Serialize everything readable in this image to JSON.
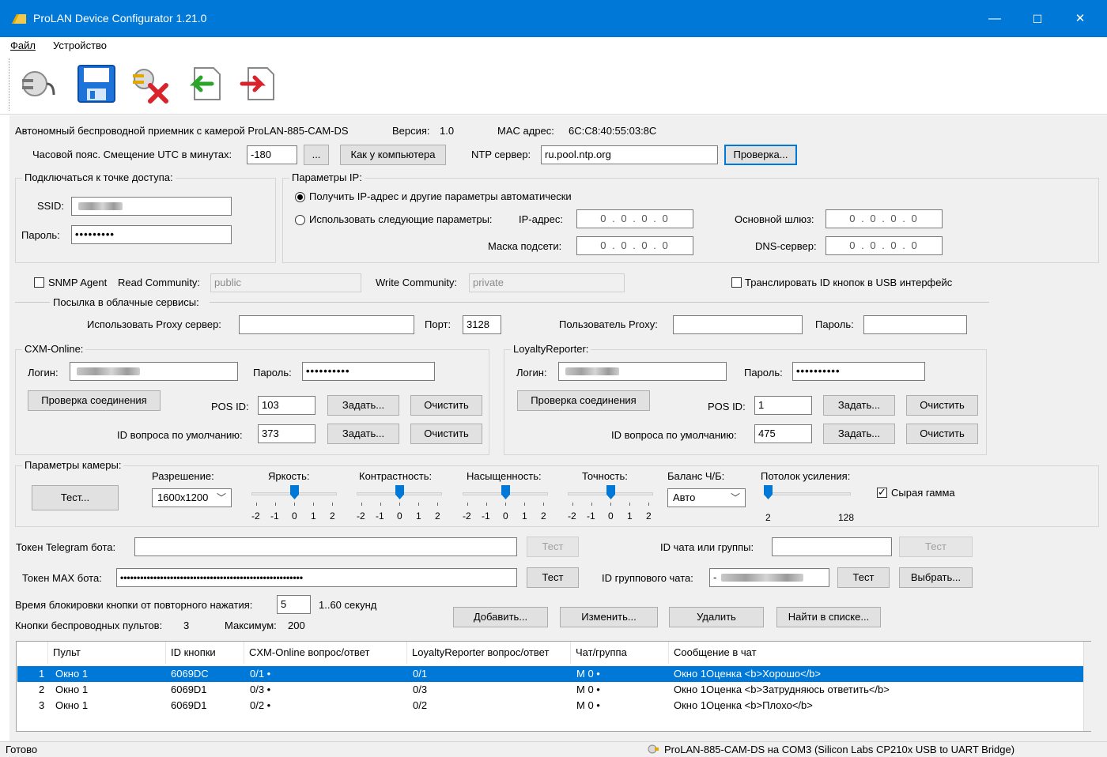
{
  "window": {
    "title": "ProLAN Device Configurator 1.21.0",
    "minimize": "—",
    "maximize": "☐",
    "close": "✕"
  },
  "menu": {
    "file": "Файл",
    "device": "Устройство"
  },
  "toolbar": {
    "icons": [
      "connect-icon",
      "save-icon",
      "disconnect-icon",
      "import-icon",
      "export-icon"
    ]
  },
  "device": {
    "name": "Автономный беспроводной приемник с камерой ProLAN-885-CAM-DS",
    "version_label": "Версия:",
    "version": "1.0",
    "mac_label": "MAC адрес:",
    "mac": "6C:C8:40:55:03:8C"
  },
  "time": {
    "tz_label": "Часовой пояс. Смещение UTC в минутах:",
    "tz_value": "-180",
    "ellipsis_button": "...",
    "like_pc_button": "Как у компьютера",
    "ntp_label": "NTP сервер:",
    "ntp_value": "ru.pool.ntp.org",
    "check_button": "Проверка..."
  },
  "wifi": {
    "group_title": "Подключаться к точке доступа:",
    "ssid_label": "SSID:",
    "password_label": "Пароль:",
    "password_value": "•••••••••"
  },
  "ip": {
    "group_title": "Параметры IP:",
    "auto_label": "Получить IP-адрес и другие параметры автоматически",
    "manual_label": "Использовать следующие параметры:",
    "ip_label": "IP-адрес:",
    "mask_label": "Маска подсети:",
    "gateway_label": "Основной шлюз:",
    "dns_label": "DNS-сервер:",
    "ip_value": "0 . 0 . 0 . 0",
    "mask_value": "0 . 0 . 0 . 0",
    "gateway_value": "0 . 0 . 0 . 0",
    "dns_value": "0 . 0 . 0 . 0"
  },
  "snmp": {
    "agent_label": "SNMP Agent",
    "read_label": "Read Community:",
    "read_value": "public",
    "write_label": "Write Community:",
    "write_value": "private",
    "usb_label": "Транслировать ID кнопок в USB интерфейс"
  },
  "cloud": {
    "section_title": "Посылка в облачные сервисы:",
    "proxy_label": "Использовать Proxy сервер:",
    "port_label": "Порт:",
    "port_value": "3128",
    "proxy_user_label": "Пользователь Proxy:",
    "proxy_password_label": "Пароль:"
  },
  "cxm": {
    "group_title": "CXM-Online:",
    "login_label": "Логин:",
    "password_label": "Пароль:",
    "password_value": "••••••••••",
    "check_button": "Проверка соединения",
    "pos_label": "POS ID:",
    "pos_value": "103",
    "set_button": "Задать...",
    "clear_button": "Очистить",
    "question_label": "ID вопроса по умолчанию:",
    "question_value": "373"
  },
  "loyalty": {
    "group_title": "LoyaltyReporter:",
    "login_label": "Логин:",
    "password_label": "Пароль:",
    "password_value": "••••••••••",
    "check_button": "Проверка соединения",
    "pos_label": "POS ID:",
    "pos_value": "1",
    "set_button": "Задать...",
    "clear_button": "Очистить",
    "question_label": "ID вопроса по умолчанию:",
    "question_value": "475"
  },
  "camera": {
    "group_title": "Параметры камеры:",
    "test_button": "Тест...",
    "resolution_label": "Разрешение:",
    "resolution_value": "1600x1200",
    "brightness_label": "Яркость:",
    "contrast_label": "Контрастность:",
    "saturation_label": "Насыщенность:",
    "sharpness_label": "Точность:",
    "bw_label": "Баланс Ч/Б:",
    "bw_value": "Авто",
    "gain_label": "Потолок усиления:",
    "gain_min": "2",
    "gain_max": "128",
    "raw_gamma_label": "Сырая гамма",
    "scale": [
      "-2",
      "-1",
      "0",
      "1",
      "2"
    ]
  },
  "telegram": {
    "token_label": "Токен Telegram бота:",
    "test_button": "Тест",
    "chat_label": "ID чата или группы:",
    "chat_test_button": "Тест"
  },
  "max": {
    "token_label": "Токен MAX бота:",
    "token_value": "•••••••••••••••••••••••••••••••••••••••••••••••••••••••",
    "test_button": "Тест",
    "group_label": "ID группового чата:",
    "group_prefix": "-",
    "group_test_button": "Тест",
    "choose_button": "Выбрать..."
  },
  "buttons": {
    "block_label": "Время блокировки кнопки от повторного нажатия:",
    "block_value": "5",
    "block_range": "1..60 секунд",
    "count_label": "Кнопки беспроводных пультов:",
    "count_value": "3",
    "max_label": "Максимум:",
    "max_value": "200",
    "add": "Добавить...",
    "edit": "Изменить...",
    "delete": "Удалить",
    "find": "Найти в списке..."
  },
  "table": {
    "headers": [
      "Пульт",
      "ID кнопки",
      "CXM-Online вопрос/ответ",
      "LoyaltyReporter вопрос/ответ",
      "Чат/группа",
      "Сообщение в чат"
    ],
    "rows": [
      {
        "num": "1",
        "remote": "Окно 1",
        "id": "6069DC",
        "cxm": "0/1 •",
        "loyalty": "0/1",
        "chat": "M 0 •",
        "message": "Окно 1Оценка <b>Хорошо</b>"
      },
      {
        "num": "2",
        "remote": "Окно 1",
        "id": "6069D1",
        "cxm": "0/3 •",
        "loyalty": "0/3",
        "chat": "M 0 •",
        "message": "Окно 1Оценка <b>Затрудняюсь ответить</b>"
      },
      {
        "num": "3",
        "remote": "Окно 1",
        "id": "6069D1",
        "cxm": "0/2 •",
        "loyalty": "0/2",
        "chat": "M 0 •",
        "message": "Окно 1Оценка <b>Плохо</b>"
      }
    ]
  },
  "status": {
    "left": "Готово",
    "right": "ProLAN-885-CAM-DS на COM3 (Silicon Labs CP210x USB to UART Bridge)"
  },
  "colors": {
    "accent": "#0078d7",
    "background": "#f0f0f0"
  }
}
